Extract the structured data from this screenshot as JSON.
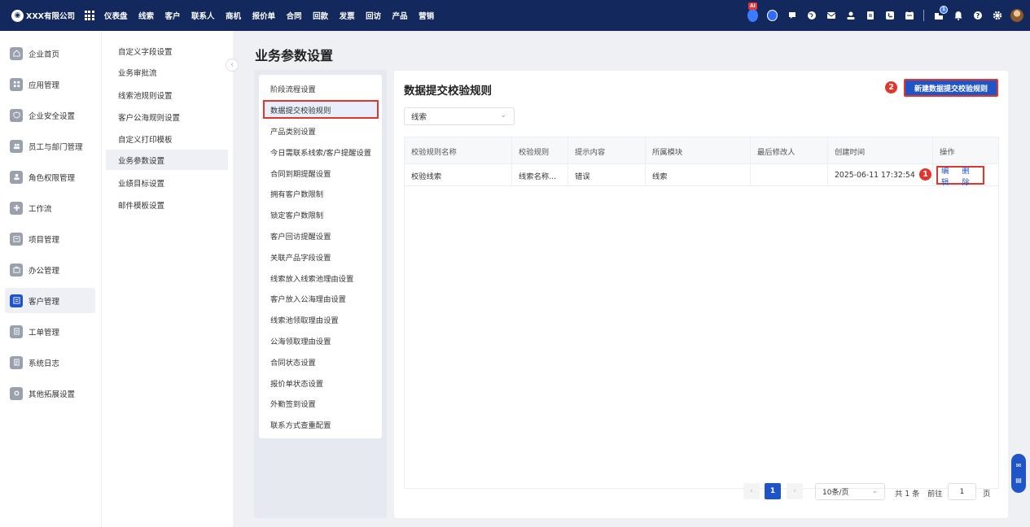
{
  "topbar": {
    "company": "XXX有限公司",
    "logo_glyph": "◉",
    "nav": [
      "仪表盘",
      "线索",
      "客户",
      "联系人",
      "商机",
      "报价单",
      "合同",
      "回款",
      "发票",
      "回访",
      "产品",
      "营销"
    ],
    "ai_badge": "AI",
    "notification_count": "1"
  },
  "sidebar": {
    "items": [
      "企业首页",
      "应用管理",
      "企业安全设置",
      "员工与部门管理",
      "角色权限管理",
      "工作流",
      "项目管理",
      "办公管理",
      "客户管理",
      "工单管理",
      "系统日志",
      "其他拓展设置"
    ],
    "active_index": 8
  },
  "subsidebar": {
    "items": [
      "自定义字段设置",
      "业务审批流",
      "线索池规则设置",
      "客户公海规则设置",
      "自定义打印模板",
      "业务参数设置",
      "业绩目标设置",
      "邮件模板设置"
    ],
    "active_index": 5
  },
  "page": {
    "title": "业务参数设置"
  },
  "settings": {
    "items": [
      "阶段流程设置",
      "数据提交校验规则",
      "产品类别设置",
      "今日需联系线索/客户提醒设置",
      "合同到期提醒设置",
      "拥有客户数限制",
      "锁定客户数限制",
      "客户回访提醒设置",
      "关联产品字段设置",
      "线索放入线索池理由设置",
      "客户放入公海理由设置",
      "线索池领取理由设置",
      "公海领取理由设置",
      "合同状态设置",
      "报价单状态设置",
      "外勤签到设置",
      "联系方式查重配置"
    ],
    "active_index": 1
  },
  "content": {
    "title": "数据提交校验规则",
    "new_button": "新建数据提交校验规则",
    "marker_new": "2",
    "marker_ops": "1",
    "filter_value": "线索",
    "table": {
      "headers": [
        "校验规则名称",
        "校验规则",
        "提示内容",
        "所属模块",
        "最后修改人",
        "创建时间",
        "操作"
      ],
      "rows": [
        {
          "name": "校验线索",
          "rule": "线索名称...",
          "tip": "错误",
          "module": "线索",
          "modifier": "",
          "created": "2025-06-11 17:32:54",
          "edit": "编辑",
          "delete": "删除"
        }
      ]
    },
    "pagination": {
      "prev": "‹",
      "current": "1",
      "next": "›",
      "page_size": "10条/页",
      "total": "共 1 条",
      "goto_label": "前往",
      "goto_value": "1",
      "page_suffix": "页"
    }
  },
  "float_tools": {
    "top": "✉",
    "bottom": "▤"
  }
}
